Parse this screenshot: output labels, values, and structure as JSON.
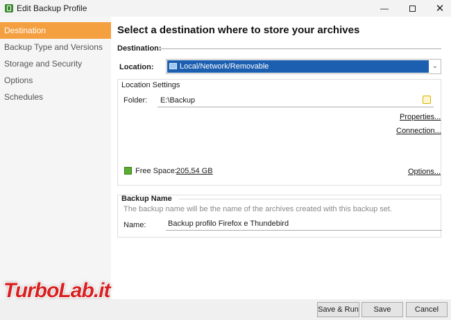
{
  "window": {
    "title": "Edit Backup Profile"
  },
  "sidebar": {
    "items": [
      {
        "label": "Destination",
        "active": true
      },
      {
        "label": "Backup Type and Versions",
        "active": false
      },
      {
        "label": "Storage and Security",
        "active": false
      },
      {
        "label": "Options",
        "active": false
      },
      {
        "label": "Schedules",
        "active": false
      }
    ]
  },
  "main": {
    "title": "Select a destination where to store your archives",
    "destination_section": "Destination:",
    "location_label": "Location:",
    "location_value": "Local/Network/Removable",
    "location_settings": {
      "title": "Location Settings",
      "folder_label": "Folder:",
      "folder_value": "E:\\Backup",
      "properties_link": "Properties...",
      "connection_link": "Connection...",
      "free_space_label": "Free Space:",
      "free_space_value": "205,54 GB",
      "options_link": "Options..."
    },
    "backup_name": {
      "title": "Backup Name",
      "description": "The backup name will be the name of the archives created with this backup set.",
      "name_label": "Name:",
      "name_value": "Backup profilo Firefox e Thundebird"
    }
  },
  "footer": {
    "save_run_label": "Save & Run",
    "save_label": "Save",
    "cancel_label": "Cancel"
  },
  "watermark": "TurboLab.it",
  "colors": {
    "active_nav": "#f4a040",
    "selection": "#1c5fb0",
    "free_space": "#5bad2f"
  }
}
